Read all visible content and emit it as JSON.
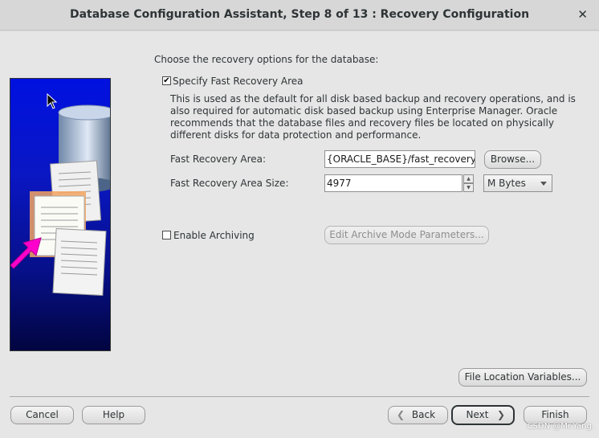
{
  "window": {
    "title": "Database Configuration Assistant, Step 8 of 13 : Recovery Configuration",
    "close_glyph": "✕"
  },
  "intro_text": "Choose the recovery options for the database:",
  "fast_recovery": {
    "checkbox_label": "Specify Fast Recovery Area",
    "checked": true,
    "description": "This is used as the default for all disk based backup and recovery operations, and is also required for automatic disk based backup using Enterprise Manager. Oracle recommends that the database files and recovery files be located on physically different disks for data protection and performance.",
    "area_label": "Fast Recovery Area:",
    "area_value": "{ORACLE_BASE}/fast_recovery_a",
    "browse_label": "Browse...",
    "size_label": "Fast Recovery Area Size:",
    "size_value": "4977",
    "unit_selected": "M Bytes"
  },
  "archiving": {
    "checkbox_label": "Enable Archiving",
    "checked": false,
    "edit_params_label": "Edit Archive Mode Parameters..."
  },
  "file_location_label": "File Location Variables...",
  "footer": {
    "cancel_label": "Cancel",
    "help_label": "Help",
    "back_label": "Back",
    "next_label": "Next",
    "finish_label": "Finish"
  },
  "watermark": "CSDN @Mr.Yang.",
  "colors": {
    "panel_top": "#0011e0",
    "panel_bottom": "#020540",
    "arrow": "#ff00cc",
    "highlight_doc": "#f4a460"
  }
}
